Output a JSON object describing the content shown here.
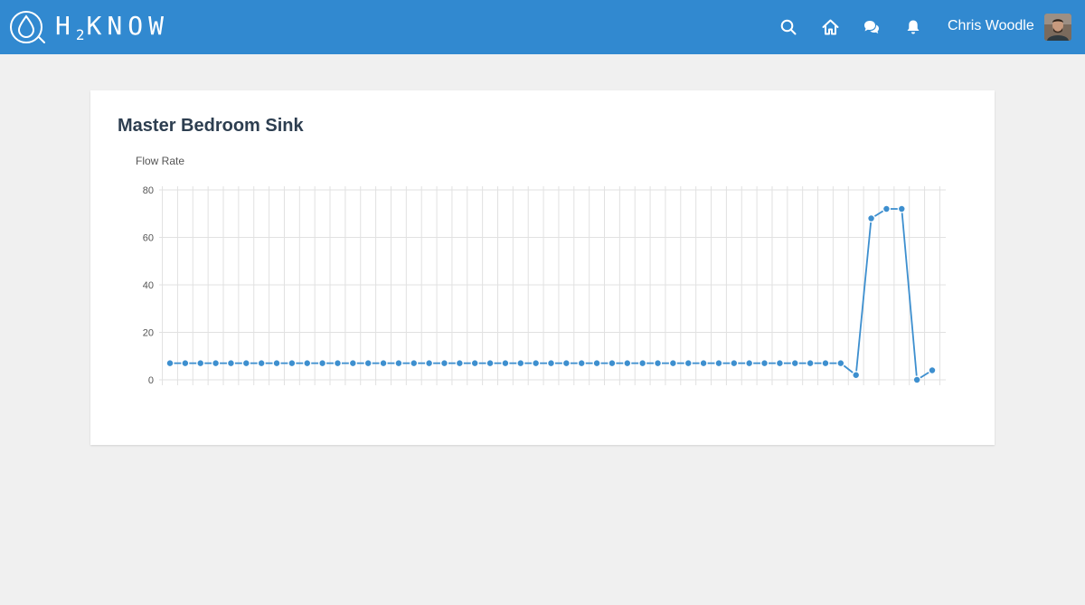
{
  "header": {
    "brand": {
      "letters_before": "H",
      "subscript": "2",
      "letters_after": "KNOW"
    },
    "icons": {
      "search": "search-icon",
      "home": "home-icon",
      "messages": "chat-bubbles-icon",
      "notifications": "bell-icon"
    },
    "user_name": "Chris Woodle",
    "colors": {
      "bar": "#3189d0",
      "text": "#ffffff"
    }
  },
  "card": {
    "title": "Master Bedroom Sink"
  },
  "chart_data": {
    "type": "line",
    "title": "Master Bedroom Sink",
    "ylabel": "Flow Rate",
    "xlabel": "",
    "ylim": [
      0,
      80
    ],
    "y_ticks": [
      0,
      20,
      40,
      60,
      80
    ],
    "grid": true,
    "color": "#3d8fcf",
    "series": [
      {
        "values": [
          7,
          7,
          7,
          7,
          7,
          7,
          7,
          7,
          7,
          7,
          7,
          7,
          7,
          7,
          7,
          7,
          7,
          7,
          7,
          7,
          7,
          7,
          7,
          7,
          7,
          7,
          7,
          7,
          7,
          7,
          7,
          7,
          7,
          7,
          7,
          7,
          7,
          7,
          7,
          7,
          7,
          7,
          7,
          7,
          7,
          2,
          68,
          72,
          72,
          0,
          4
        ]
      }
    ]
  }
}
